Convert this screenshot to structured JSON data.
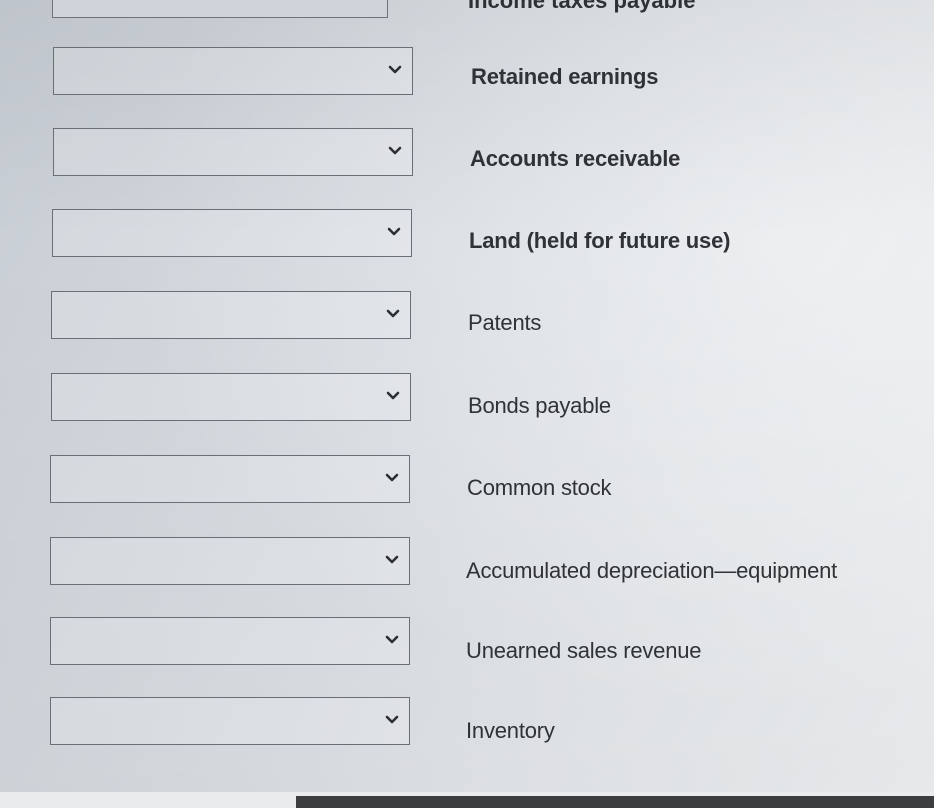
{
  "partial_top_row": {
    "label": "Income taxes payable"
  },
  "rows": [
    {
      "label": "Retained earnings",
      "selected": ""
    },
    {
      "label": "Accounts receivable",
      "selected": ""
    },
    {
      "label": "Land (held for future use)",
      "selected": ""
    },
    {
      "label": "Patents",
      "selected": ""
    },
    {
      "label": "Bonds payable",
      "selected": ""
    },
    {
      "label": "Common stock",
      "selected": ""
    },
    {
      "label": "Accumulated depreciation—equipment",
      "selected": ""
    },
    {
      "label": "Unearned sales revenue",
      "selected": ""
    },
    {
      "label": "Inventory",
      "selected": ""
    }
  ],
  "icons": {
    "dropdown": "chevron-down-icon"
  }
}
